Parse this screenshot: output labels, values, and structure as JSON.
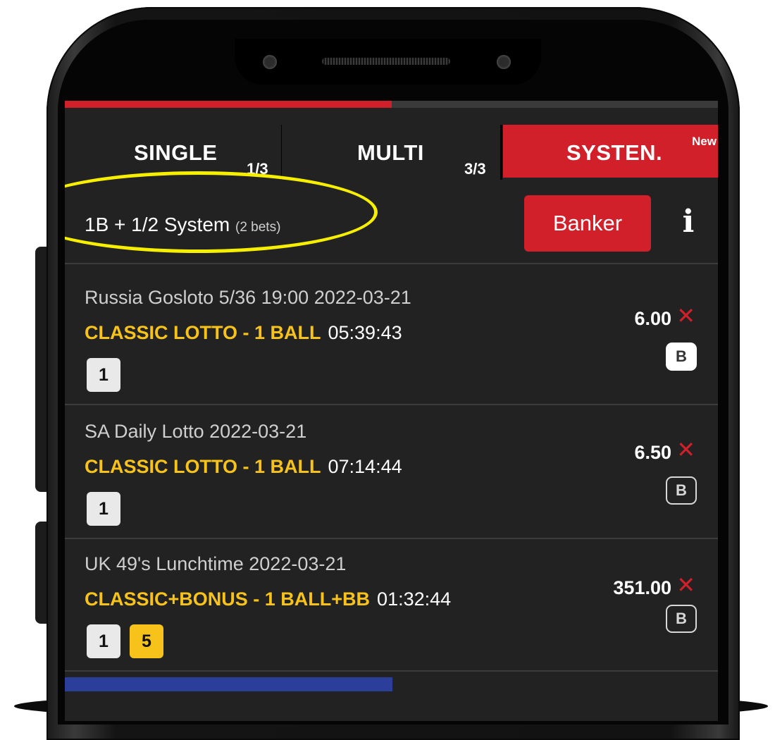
{
  "tabs": [
    {
      "label": "SINGLE",
      "count": "1/3"
    },
    {
      "label": "MULTI",
      "count": "3/3"
    },
    {
      "label": "SYSTEN.",
      "badge": "New"
    }
  ],
  "system": {
    "summary": "1B + 1/2 System",
    "bets_label": "(2 bets)",
    "banker_label": "Banker",
    "info_icon": "info-icon"
  },
  "bets": [
    {
      "title": "Russia Gosloto 5/36 19:00 2022-03-21",
      "market": "CLASSIC LOTTO - 1 BALL",
      "timer": "05:39:43",
      "balls": [
        {
          "value": "1",
          "color": "white"
        }
      ],
      "odds": "6.00",
      "banker_toggle": "B",
      "banker_selected": true
    },
    {
      "title": "SA Daily Lotto 2022-03-21",
      "market": "CLASSIC LOTTO - 1 BALL",
      "timer": "07:14:44",
      "balls": [
        {
          "value": "1",
          "color": "white"
        }
      ],
      "odds": "6.50",
      "banker_toggle": "B",
      "banker_selected": false
    },
    {
      "title": "UK 49's Lunchtime 2022-03-21",
      "market": "CLASSIC+BONUS - 1 BALL+BB",
      "timer": "01:32:44",
      "balls": [
        {
          "value": "1",
          "color": "white"
        },
        {
          "value": "5",
          "color": "yellow"
        }
      ],
      "odds": "351.00",
      "banker_toggle": "B",
      "banker_selected": false
    }
  ],
  "icons": {
    "remove": "✕"
  },
  "colors": {
    "accent_red": "#d2202a",
    "market_yellow": "#f7c31a",
    "highlight_yellow": "#f7ef00",
    "screen_bg": "#222222"
  },
  "top_progress_fraction": 0.5
}
